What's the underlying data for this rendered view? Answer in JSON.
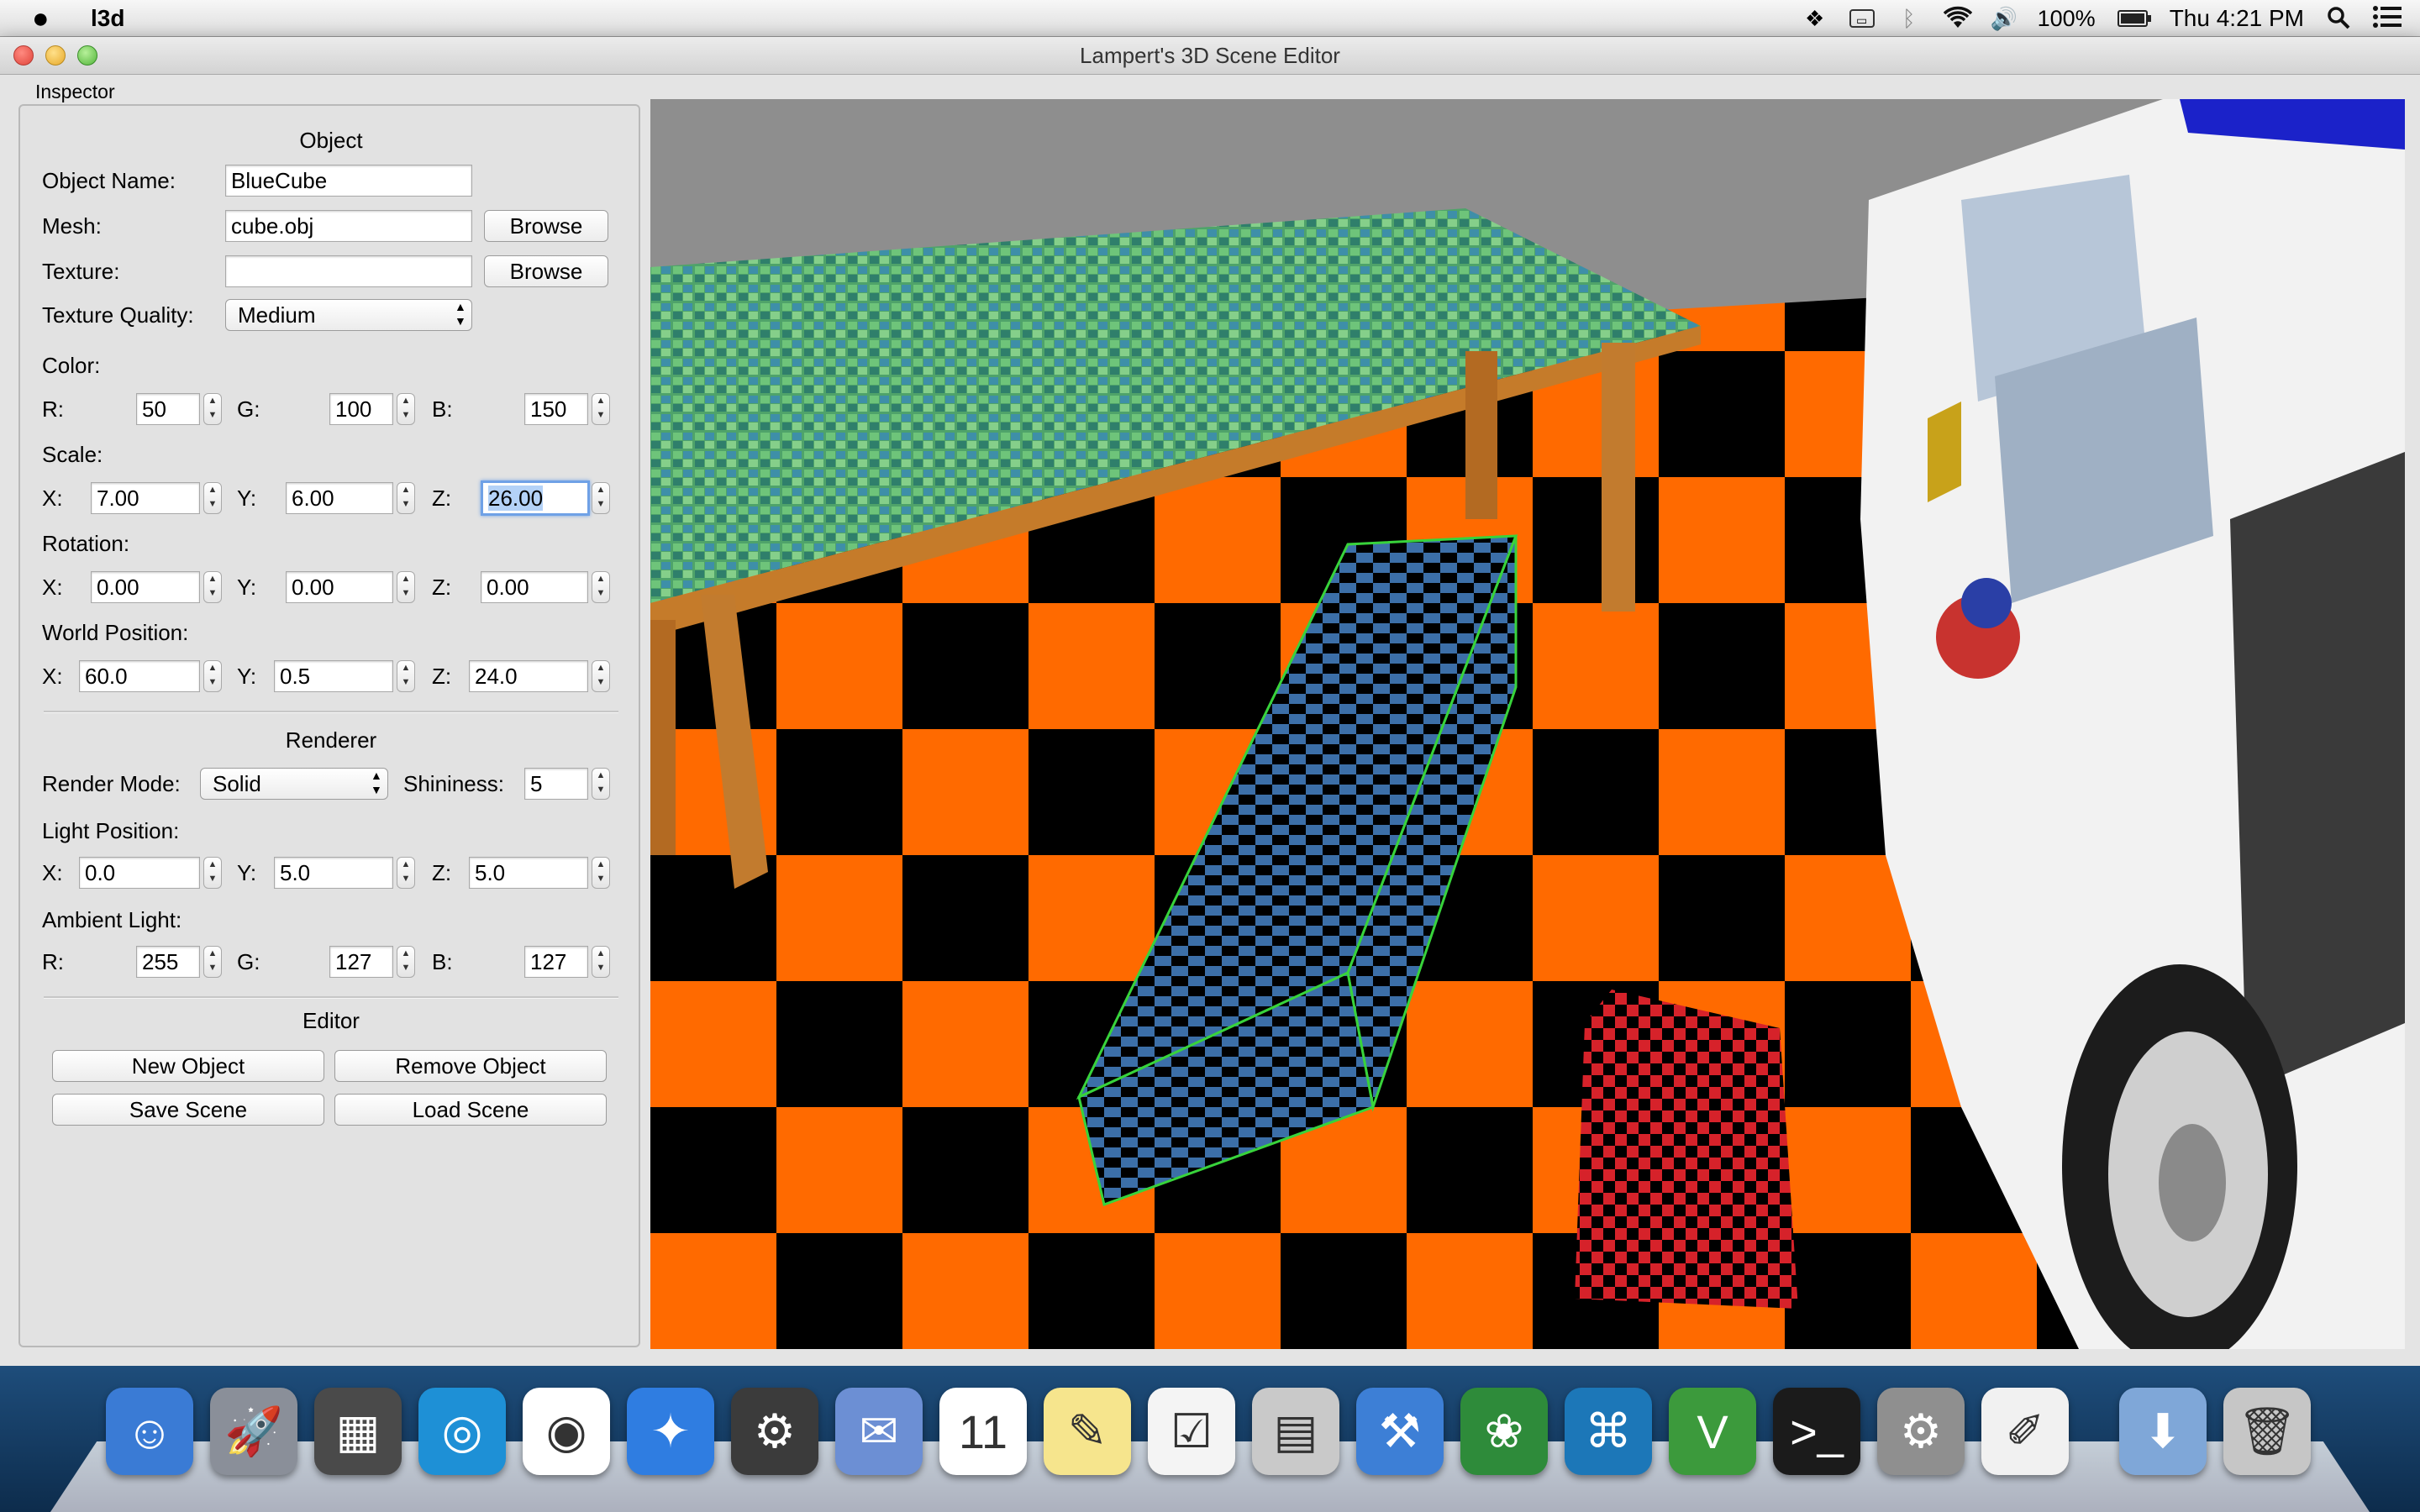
{
  "menubar": {
    "app_name": "l3d",
    "battery_percent": "100%",
    "clock": "Thu 4:21 PM",
    "icons": [
      "apple-icon",
      "dropbox-icon",
      "display-icon",
      "bluetooth-icon",
      "wifi-icon",
      "volume-icon",
      "battery-icon",
      "spotlight-icon",
      "notification-center-icon"
    ]
  },
  "window": {
    "title": "Lampert's 3D Scene Editor"
  },
  "inspector": {
    "label": "Inspector",
    "object": {
      "section": "Object",
      "name_label": "Object Name:",
      "name_value": "BlueCube",
      "mesh_label": "Mesh:",
      "mesh_value": "cube.obj",
      "texture_label": "Texture:",
      "texture_value": "",
      "browse_label": "Browse",
      "quality_label": "Texture Quality:",
      "quality_value": "Medium",
      "color_label": "Color:",
      "color": {
        "r_label": "R:",
        "r": "50",
        "g_label": "G:",
        "g": "100",
        "b_label": "B:",
        "b": "150"
      },
      "scale_label": "Scale:",
      "scale": {
        "x_label": "X:",
        "x": "7.00",
        "y_label": "Y:",
        "y": "6.00",
        "z_label": "Z:",
        "z": "26.00"
      },
      "rotation_label": "Rotation:",
      "rotation": {
        "x": "0.00",
        "y": "0.00",
        "z": "0.00"
      },
      "world_label": "World Position:",
      "world": {
        "x": "60.0",
        "y": "0.5",
        "z": "24.0"
      }
    },
    "renderer": {
      "section": "Renderer",
      "mode_label": "Render Mode:",
      "mode_value": "Solid",
      "shininess_label": "Shininess:",
      "shininess_value": "5",
      "light_label": "Light Position:",
      "light": {
        "x": "0.0",
        "y": "5.0",
        "z": "5.0"
      },
      "ambient_label": "Ambient Light:",
      "ambient": {
        "r": "255",
        "g": "127",
        "b": "127"
      }
    },
    "editor": {
      "section": "Editor",
      "new_object": "New Object",
      "remove_object": "Remove Object",
      "save_scene": "Save Scene",
      "load_scene": "Load Scene"
    }
  },
  "viewport": {
    "floor_colors": [
      "#ff6a00",
      "#000000"
    ],
    "sky_color": "#8e8e8e",
    "selected_object": "BlueCube"
  },
  "dock": {
    "items": [
      {
        "name": "finder-icon",
        "color": "#3a7bd5",
        "glyph": "☺"
      },
      {
        "name": "launchpad-icon",
        "color": "#8a8f99",
        "glyph": "🚀"
      },
      {
        "name": "photo-browser-icon",
        "color": "#4a4a4a",
        "glyph": "▦"
      },
      {
        "name": "dashboard-icon",
        "color": "#1e90d6",
        "glyph": "◎"
      },
      {
        "name": "chrome-icon",
        "color": "#ffffff",
        "glyph": "◉"
      },
      {
        "name": "safari-icon",
        "color": "#2f7de1",
        "glyph": "✦"
      },
      {
        "name": "steam-icon",
        "color": "#3b3b3b",
        "glyph": "⚙"
      },
      {
        "name": "mail-icon",
        "color": "#6c8fd4",
        "glyph": "✉"
      },
      {
        "name": "calendar-icon",
        "color": "#ffffff",
        "glyph": "11"
      },
      {
        "name": "notes-icon",
        "color": "#f6e58d",
        "glyph": "✎"
      },
      {
        "name": "reminders-icon",
        "color": "#f4f4f4",
        "glyph": "☑"
      },
      {
        "name": "calculator-icon",
        "color": "#c9c9c9",
        "glyph": "▤"
      },
      {
        "name": "xcode-icon",
        "color": "#3d7fd6",
        "glyph": "⚒"
      },
      {
        "name": "lotus-app-icon",
        "color": "#2e8b3a",
        "glyph": "❀"
      },
      {
        "name": "sourcetree-icon",
        "color": "#1c77b8",
        "glyph": "⌘"
      },
      {
        "name": "vim-icon",
        "color": "#3c9a3c",
        "glyph": "V"
      },
      {
        "name": "terminal-icon",
        "color": "#1b1b1b",
        "glyph": ">_"
      },
      {
        "name": "system-preferences-icon",
        "color": "#8f8f8f",
        "glyph": "⚙"
      },
      {
        "name": "textedit-icon",
        "color": "#f1f1f1",
        "glyph": "✐"
      },
      {
        "name": "downloads-folder-icon",
        "color": "#7fa7d8",
        "glyph": "⬇"
      },
      {
        "name": "trash-icon",
        "color": "#c6c6c6",
        "glyph": "🗑"
      }
    ]
  }
}
